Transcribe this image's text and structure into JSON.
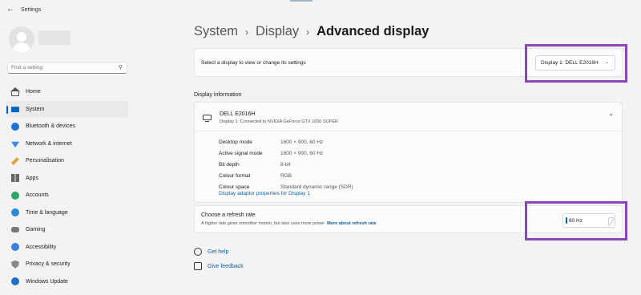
{
  "window": {
    "title": "Settings"
  },
  "search": {
    "placeholder": "Find a setting"
  },
  "sidebar": {
    "items": [
      {
        "label": "Home",
        "icon": "home-icon"
      },
      {
        "label": "System",
        "icon": "system-icon",
        "active": true
      },
      {
        "label": "Bluetooth & devices",
        "icon": "bluetooth-icon"
      },
      {
        "label": "Network & internet",
        "icon": "network-icon"
      },
      {
        "label": "Personalisation",
        "icon": "personalisation-icon"
      },
      {
        "label": "Apps",
        "icon": "apps-icon"
      },
      {
        "label": "Accounts",
        "icon": "accounts-icon"
      },
      {
        "label": "Time & language",
        "icon": "time-language-icon"
      },
      {
        "label": "Gaming",
        "icon": "gaming-icon"
      },
      {
        "label": "Accessibility",
        "icon": "accessibility-icon"
      },
      {
        "label": "Privacy & security",
        "icon": "privacy-icon"
      },
      {
        "label": "Windows Update",
        "icon": "windows-update-icon"
      }
    ]
  },
  "breadcrumb": {
    "part1": "System",
    "part2": "Display",
    "current": "Advanced display"
  },
  "select_display": {
    "text": "Select a display to view or change its settings",
    "selected": "Display 1: DELL E2016H"
  },
  "display_information": {
    "heading": "Display information",
    "name": "DELL E2016H",
    "subtitle": "Display 1: Connected to NVIDIA GeForce GTX 1650 SUPER",
    "rows": [
      {
        "label": "Desktop mode",
        "value": "1600 × 900, 60 Hz"
      },
      {
        "label": "Active signal mode",
        "value": "1600 × 900, 60 Hz"
      },
      {
        "label": "Bit depth",
        "value": "8-bit"
      },
      {
        "label": "Colour format",
        "value": "RGB"
      },
      {
        "label": "Colour space",
        "value": "Standard dynamic range (SDR)"
      }
    ],
    "adapter_link": "Display adaptor properties for Display 1"
  },
  "refresh_rate": {
    "title": "Choose a refresh rate",
    "description": "A higher rate gives smoother motion, but also uses more power",
    "link": "More about refresh rate",
    "selected": "60 Hz"
  },
  "footer": {
    "help": "Get help",
    "feedback": "Give feedback"
  },
  "colors": {
    "accent": "#005fb8",
    "highlight": "#8e44bd",
    "link": "#0f5ea8"
  }
}
